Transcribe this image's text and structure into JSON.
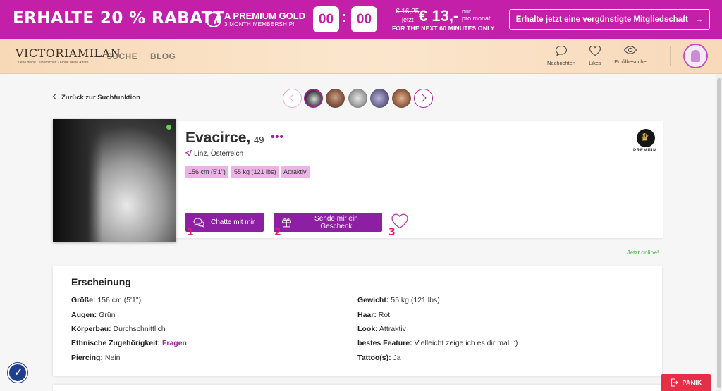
{
  "promo": {
    "headline": "ERHALTE 20 % RABATT",
    "gold_title": "A PREMIUM GOLD",
    "gold_sub": "3 MONTH MEMBERSHIP!",
    "timer_minutes": "00",
    "timer_seconds": "00",
    "timer_separator": ":",
    "old_price": "€ 16,25",
    "jetzt": "jetzt",
    "new_price": "€ 13,-",
    "nur": "nur",
    "pro_monat": "pro monat",
    "next_minutes": "FOR THE NEXT 60 MINUTES ONLY",
    "cta_label": "Erhalte jetzt eine vergünstigte Mitgliedschaft",
    "cta_arrow": "→",
    "color": "#c41fa8"
  },
  "nav": {
    "logo": "VICTORIAMILAN",
    "logo_tagline": "Lebe deine Leidenschaft - Finde deine Affäre",
    "links": [
      "SUCHE",
      "BLOG"
    ],
    "icons": [
      {
        "icon": "chat-bubble-icon",
        "label": "Nachrichten"
      },
      {
        "icon": "heart-icon",
        "label": "Likes"
      },
      {
        "icon": "eye-icon",
        "label": "Profilbesuche"
      }
    ]
  },
  "profile": {
    "back_label": "Zurück zur Suchfunktion",
    "name": "Evacirce,",
    "age": "49",
    "more": "•••",
    "location": "Linz, Österreich",
    "tags": [
      "156 cm (5'1\")",
      "55 kg (121 lbs)",
      "Attraktiv"
    ],
    "premium_label": "PREMIUM",
    "chat_button": "Chatte mit mir",
    "gift_button": "Sende mir ein Geschenk",
    "markers": [
      "1",
      "2",
      "3"
    ],
    "online_text": "Jetzt online!",
    "accent": "#8d1fa3"
  },
  "appearance": {
    "title": "Erscheinung",
    "left": [
      {
        "label": "Größe:",
        "value": "156 cm (5'1\")"
      },
      {
        "label": "Augen:",
        "value": "Grün"
      },
      {
        "label": "Körperbau:",
        "value": "Durchschnittlich"
      },
      {
        "label": "Ethnische Zugehörigkeit:",
        "value": "Fragen"
      },
      {
        "label": "Piercing:",
        "value": "Nein"
      }
    ],
    "right": [
      {
        "label": "Gewicht:",
        "value": "55 kg (121 lbs)"
      },
      {
        "label": "Haar:",
        "value": "Rot"
      },
      {
        "label": "Look:",
        "value": "Attraktiv"
      },
      {
        "label": "bestes Feature:",
        "value": "Vielleicht zeige ich es dir mal! :)"
      },
      {
        "label": "Tattoo(s):",
        "value": "Ja"
      }
    ]
  },
  "panic_label": "PANIK"
}
